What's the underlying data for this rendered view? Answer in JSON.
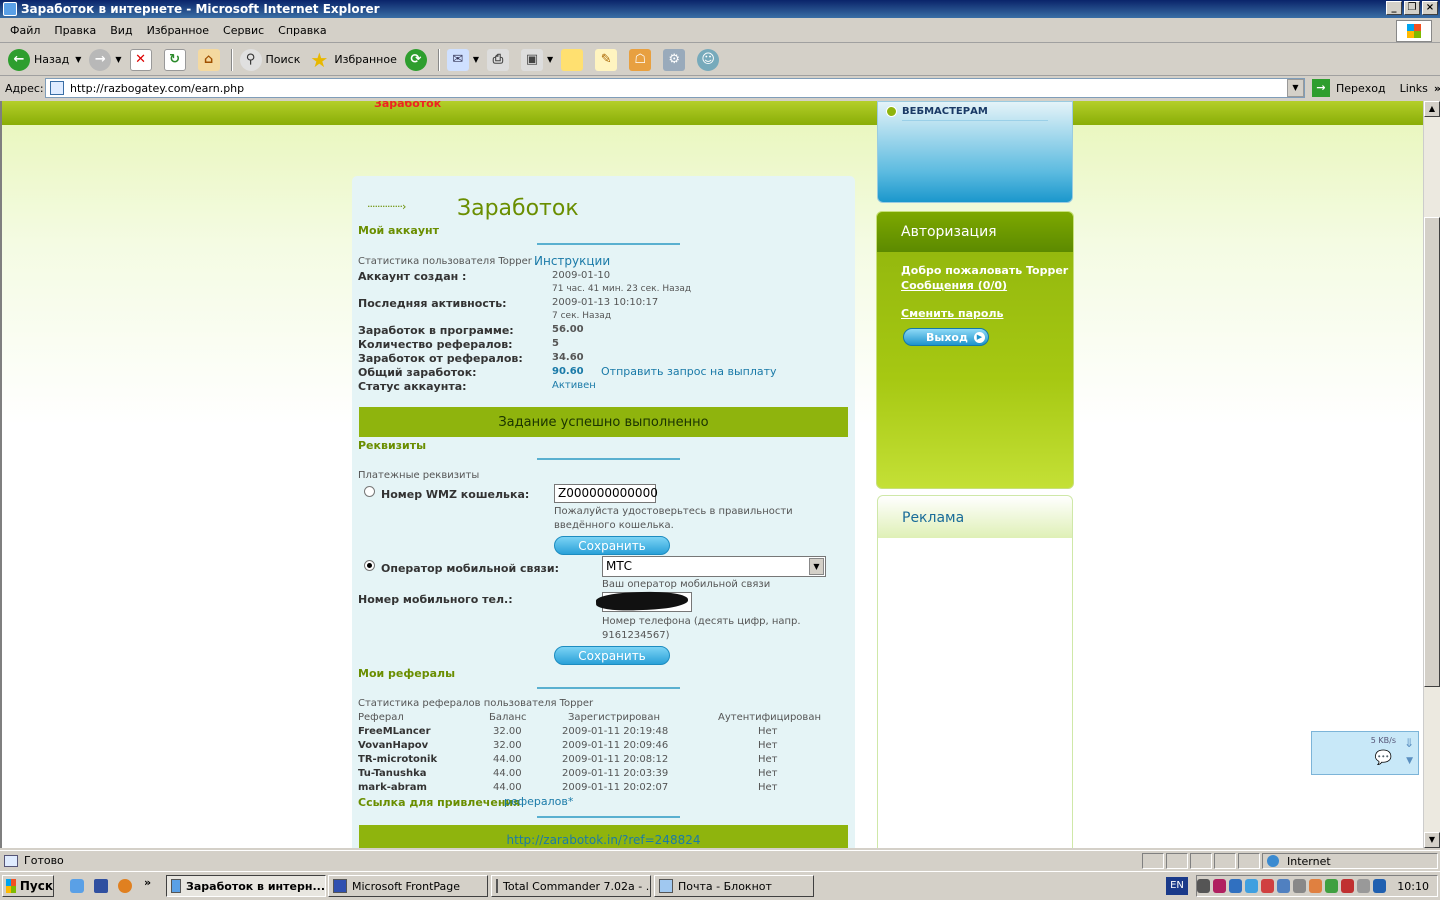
{
  "window": {
    "title": "Заработок в интернете - Microsoft Internet Explorer"
  },
  "menu": [
    "Файл",
    "Правка",
    "Вид",
    "Избранное",
    "Сервис",
    "Справка"
  ],
  "toolbar": {
    "back": "Назад",
    "search": "Поиск",
    "favorites": "Избранное"
  },
  "address": {
    "label": "Адрес:",
    "url": "http://razbogatey.com/earn.php",
    "go": "Переход",
    "links": "Links"
  },
  "page": {
    "top_link": "Заработок",
    "heading_dots": "··············›",
    "heading": "Заработок",
    "my_account": {
      "title": "Мой аккаунт",
      "stats_intro": "Статистика пользователя Topper",
      "instructions_link": "Инструкции",
      "rows": [
        {
          "label": "Аккаунт создан :",
          "value": "2009-01-10",
          "sub": "71 час. 41 мин. 23 сек. Назад"
        },
        {
          "label": "Последняя активность:",
          "value": "2009-01-13 10:10:17",
          "sub": "7 сек. Назад"
        },
        {
          "label": "Заработок в программе:",
          "value": "56.00"
        },
        {
          "label": "Количество рефералов:",
          "value": "5"
        },
        {
          "label": "Заработок от рефералов:",
          "value": "34.60"
        },
        {
          "label": "Общий заработок:",
          "value": "90.60",
          "link": "Отправить запрос на выплату"
        },
        {
          "label": "Статус аккаунта:",
          "value": "Активен"
        }
      ]
    },
    "success_message": "Задание успешно выполненно",
    "requisites": {
      "title": "Реквизиты",
      "subtitle": "Платежные реквизиты",
      "wmz_label": "Номер WMZ кошелька:",
      "wmz_value": "Z000000000000",
      "wmz_hint": "Пожалуйста удостоверьтесь в правильности введённого кошелька.",
      "save": "Сохранить",
      "operator_label": "Оператор мобильной связи:",
      "operator_value": "МТС",
      "operator_hint": "Ваш оператор мобильной связи",
      "phone_label": "Номер мобильного тел.:",
      "phone_hint": "Номер телефона (десять цифр, напр. 9161234567)",
      "save2": "Сохранить"
    },
    "referrals": {
      "title": "Мои рефералы",
      "intro": "Статистика рефералов пользователя Topper",
      "columns": [
        "Реферал",
        "Баланс",
        "Зарегистрирован",
        "Аутентифицирован"
      ],
      "rows": [
        {
          "name": "FreeMLancer",
          "balance": "32.00",
          "registered": "2009-01-11 20:19:48",
          "auth": "Нет"
        },
        {
          "name": "VovanHapov",
          "balance": "32.00",
          "registered": "2009-01-11 20:09:46",
          "auth": "Нет"
        },
        {
          "name": "TR-microtonik",
          "balance": "44.00",
          "registered": "2009-01-11 20:08:12",
          "auth": "Нет"
        },
        {
          "name": "Tu-Tanushka",
          "balance": "44.00",
          "registered": "2009-01-11 20:03:39",
          "auth": "Нет"
        },
        {
          "name": "mark-abram",
          "balance": "44.00",
          "registered": "2009-01-11 20:02:07",
          "auth": "Нет"
        }
      ],
      "ref_link_label": "Ссылка для привлечения",
      "ref_link_word": "рефералов*",
      "ref_url": "http://zarabotok.in/?ref=248824"
    },
    "sidebar": {
      "webmasters": "ВЕБМАСТЕРАМ",
      "auth_title": "Авторизация",
      "welcome": "Добро пожаловать Topper",
      "messages": "Сообщения (0/0)",
      "change_password": "Сменить пароль",
      "logout": "Выход",
      "ads_title": "Реклама"
    }
  },
  "speed_widget": {
    "rate": "5 KB/s"
  },
  "status": {
    "text": "Готово",
    "zone": "Internet"
  },
  "taskbar": {
    "start": "Пуск",
    "tasks": [
      "Заработок в интерн...",
      "Microsoft FrontPage",
      "Total Commander 7.02a - ...",
      "Почта - Блокнот"
    ],
    "lang": "EN",
    "clock": "10:10"
  },
  "colors": {
    "accent_green": "#8fb40d",
    "link_blue": "#1a7aa8",
    "title_blue": "#0a246a"
  }
}
